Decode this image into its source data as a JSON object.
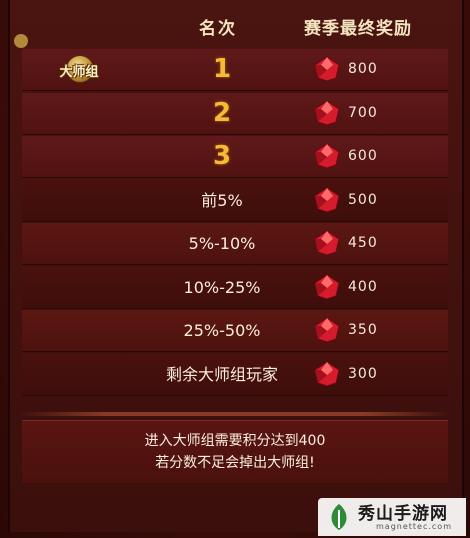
{
  "header": {
    "rank_label": "名次",
    "reward_label": "赛季最终奖励"
  },
  "badge": {
    "label": "大师组"
  },
  "rows": [
    {
      "rank": "1",
      "amount": "800",
      "style": "big"
    },
    {
      "rank": "2",
      "amount": "700",
      "style": "big"
    },
    {
      "rank": "3",
      "amount": "600",
      "style": "big"
    },
    {
      "rank": "前5%",
      "amount": "500",
      "style": "normal"
    },
    {
      "rank": "5%-10%",
      "amount": "450",
      "style": "normal"
    },
    {
      "rank": "10%-25%",
      "amount": "400",
      "style": "normal"
    },
    {
      "rank": "25%-50%",
      "amount": "350",
      "style": "normal"
    },
    {
      "rank": "剩余大师组玩家",
      "amount": "300",
      "style": "normal"
    }
  ],
  "reward_icon": "red-gem-icon",
  "notice": {
    "line1": "进入大师组需要积分达到400",
    "line2": "若分数不足会掉出大师组!"
  },
  "watermark": {
    "title": "秀山手游网",
    "subtitle": "magnettec.com"
  },
  "colors": {
    "panel": "#4a1410",
    "accent_gold": "#f6b93c",
    "gem": "#d41c2c"
  }
}
